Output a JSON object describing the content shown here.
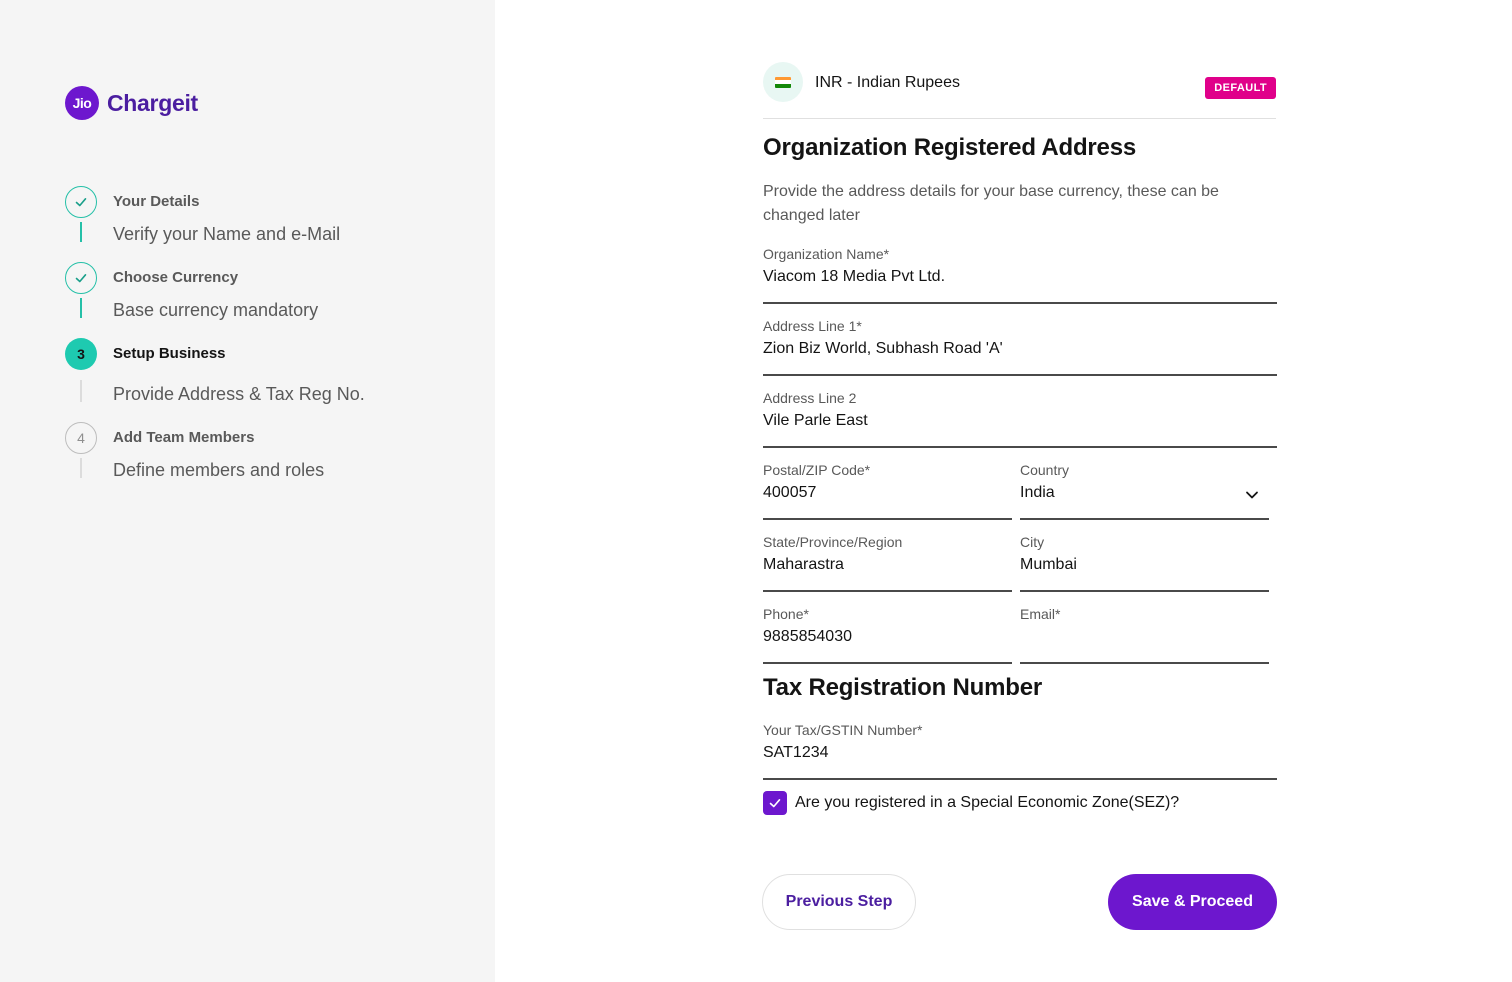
{
  "brand": {
    "logo_mark": "Jio",
    "name": "Chargeit",
    "color": "#6d17ce"
  },
  "steps": [
    {
      "title": "Your Details",
      "subtitle": "Verify your Name and e-Mail",
      "status": "done",
      "icon": "check-icon"
    },
    {
      "title": "Choose Currency",
      "subtitle": "Base currency mandatory",
      "status": "done",
      "icon": "check-icon"
    },
    {
      "number": "3",
      "title": "Setup Business",
      "subtitle": "Provide Address & Tax Reg No.",
      "status": "active"
    },
    {
      "number": "4",
      "title": "Add Team Members",
      "subtitle": "Define members and roles",
      "status": "pending"
    }
  ],
  "currency": {
    "flag_icon": "india-flag-icon",
    "name": "INR - Indian Rupees",
    "badge": "DEFAULT",
    "badge_color": "#e0008a"
  },
  "address": {
    "title": "Organization Registered Address",
    "description": "Provide the address details for your base currency, these can be changed later",
    "fields": {
      "org_name": {
        "label": "Organization Name*",
        "value": "Viacom 18 Media Pvt Ltd."
      },
      "address1": {
        "label": "Address Line 1*",
        "value": "Zion Biz World, Subhash Road 'A'"
      },
      "address2": {
        "label": "Address Line 2",
        "value": "Vile Parle East"
      },
      "postal": {
        "label": "Postal/ZIP Code*",
        "value": "400057"
      },
      "country": {
        "label": "Country",
        "value": "India"
      },
      "state": {
        "label": "State/Province/Region",
        "value": "Maharastra"
      },
      "city": {
        "label": "City",
        "value": "Mumbai"
      },
      "phone": {
        "label": "Phone*",
        "value": "9885854030"
      },
      "email": {
        "label": "Email*",
        "value": ""
      }
    }
  },
  "tax": {
    "title": "Tax Registration Number",
    "field": {
      "label": "Your Tax/GSTIN Number*",
      "value": "SAT1234"
    },
    "sez_checkbox": {
      "label": "Are you registered in a Special Economic Zone(SEZ)?",
      "checked": true
    }
  },
  "buttons": {
    "previous": "Previous Step",
    "save": "Save & Proceed"
  }
}
